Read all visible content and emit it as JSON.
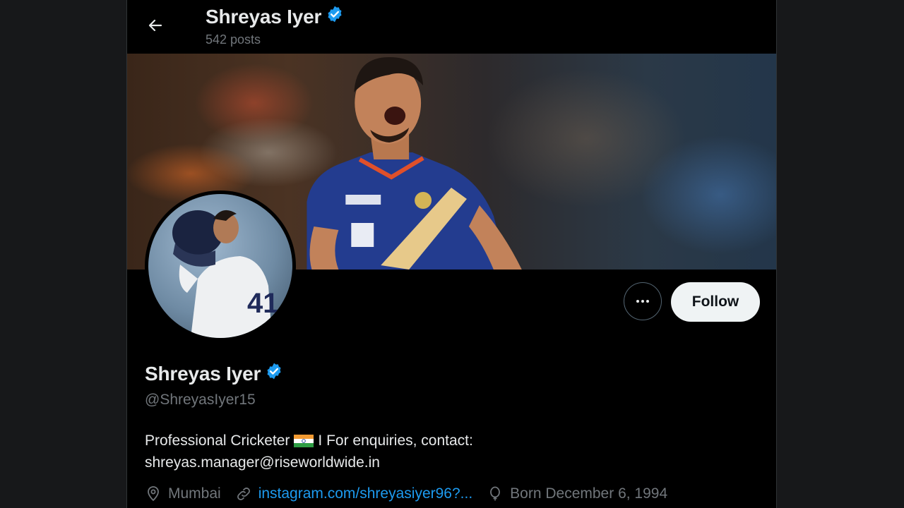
{
  "header": {
    "name": "Shreyas Iyer",
    "posts": "542 posts"
  },
  "actions": {
    "follow_label": "Follow"
  },
  "profile": {
    "name": "Shreyas Iyer",
    "handle": "@ShreyasIyer15",
    "bio_part1": "Professional Cricketer",
    "bio_part2": "I For enquiries, contact:",
    "bio_line2": "shreyas.manager@riseworldwide.in",
    "location": "Mumbai",
    "website": "instagram.com/shreyasiyer96?...",
    "birthdate": "Born December 6, 1994"
  },
  "colors": {
    "verified": "#1d9bf0",
    "link": "#1d9bf0",
    "background": "#000000",
    "muted": "#71767b"
  },
  "icons": {
    "back": "arrow-left-icon",
    "verified": "verified-badge-icon",
    "more": "more-horizontal-icon",
    "location": "location-pin-icon",
    "link": "link-icon",
    "birthday": "balloon-icon",
    "flag": "india-flag-emoji"
  }
}
